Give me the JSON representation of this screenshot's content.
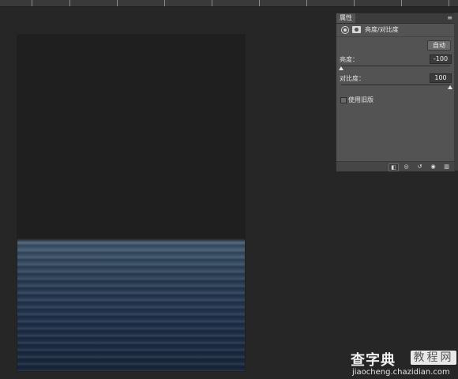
{
  "panel": {
    "tab_label": "属性",
    "menu_glyph": "≡",
    "collapse_glyph": "»",
    "title": "亮度/对比度",
    "auto_button": "自动",
    "brightness_label": "亮度：",
    "brightness_value": "-100",
    "brightness_level": 0.0,
    "contrast_label": "对比度：",
    "contrast_value": "100",
    "contrast_level": 1.0,
    "legacy_label": "使用旧版",
    "footer_icons": [
      "clip-to-layer-icon",
      "visibility-eye-icon",
      "reset-icon",
      "toggle-visibility-icon",
      "trash-icon"
    ]
  },
  "watermark": {
    "main": "查字典",
    "box": "教程网",
    "url": "jiaocheng.chazidian.com"
  },
  "colors": {
    "workspace": "#262626",
    "panel": "#535353",
    "sea_top": "#4a6076",
    "sea_bottom": "#1a263a"
  }
}
